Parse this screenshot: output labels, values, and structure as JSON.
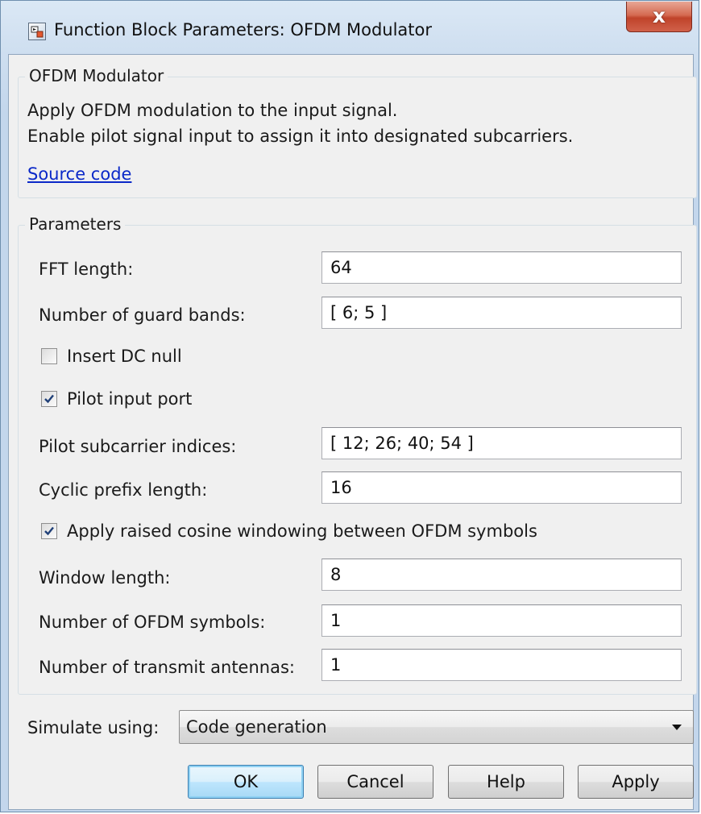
{
  "window": {
    "title": "Function Block Parameters: OFDM Modulator",
    "close_glyph": "x"
  },
  "description": {
    "group_title": "OFDM Modulator",
    "line1": "Apply OFDM modulation to the input signal.",
    "line2": "Enable pilot signal input to assign it into designated subcarriers.",
    "link": "Source code"
  },
  "parameters": {
    "group_title": "Parameters",
    "fft_length": {
      "label": "FFT length:",
      "value": "64"
    },
    "guard_bands": {
      "label": "Number of guard bands:",
      "value": "[ 6; 5 ]"
    },
    "insert_dc_null": {
      "label": "Insert DC null",
      "checked": false
    },
    "pilot_input_port": {
      "label": "Pilot input port",
      "checked": true
    },
    "pilot_indices": {
      "label": "Pilot subcarrier indices:",
      "value": "[ 12; 26; 40; 54 ]"
    },
    "cyclic_prefix": {
      "label": "Cyclic prefix length:",
      "value": "16"
    },
    "raised_cosine": {
      "label": "Apply raised cosine windowing between OFDM symbols",
      "checked": true
    },
    "window_length": {
      "label": "Window length:",
      "value": "8"
    },
    "num_symbols": {
      "label": "Number of OFDM symbols:",
      "value": "1"
    },
    "num_antennas": {
      "label": "Number of transmit antennas:",
      "value": "1"
    }
  },
  "simulate": {
    "label": "Simulate using:",
    "selected": "Code generation"
  },
  "buttons": {
    "ok": "OK",
    "cancel": "Cancel",
    "help": "Help",
    "apply": "Apply"
  },
  "colors": {
    "link": "#0b29c8",
    "close_button": "#c0432a",
    "default_button_border": "#3c7fb1"
  }
}
